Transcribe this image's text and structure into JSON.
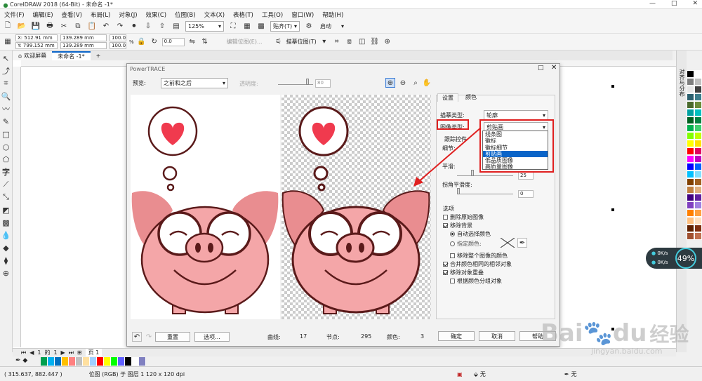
{
  "window": {
    "title": "CorelDRAW 2018 (64-Bit) - 未命名 -1*",
    "minimize": "—",
    "restore": "□",
    "close": "✕"
  },
  "menu": [
    "文件(F)",
    "编辑(E)",
    "查看(V)",
    "布局(L)",
    "对象(J)",
    "效果(C)",
    "位图(B)",
    "文本(X)",
    "表格(T)",
    "工具(O)",
    "窗口(W)",
    "帮助(H)"
  ],
  "toolbar": {
    "zoom": "125%",
    "snap": "贴齐(T)",
    "launch": "启动"
  },
  "property_bar": {
    "x": "X: 512.91 mm",
    "y": "Y: 799.152 mm",
    "width": "139.289 mm",
    "height": "139.289 mm",
    "scale_w": "100.0",
    "scale_h": "100.0",
    "pct": "%",
    "rotation": "0.0",
    "edit_bitmap": "编辑位图(E)...",
    "trace_bitmap": "描摹位图(T)"
  },
  "doc_tabs": [
    "欢迎屏幕",
    "未命名 -1*"
  ],
  "dialog": {
    "title": "PowerTRACE",
    "preview_label": "预览:",
    "preview_mode": "之前和之后",
    "transparency_label": "透明度:",
    "transparency_value": "80",
    "tab_settings": "设置",
    "tab_colors": "颜色",
    "trace_type_label": "描摹类型:",
    "trace_type_value": "轮廓",
    "image_type_label": "图像类型:",
    "image_type_value": "剪贴画",
    "image_type_options": [
      "线条图",
      "徽标",
      "徽标细节",
      "剪贴画",
      "低品质图像",
      "高质量图像"
    ],
    "image_type_selected": 3,
    "trace_controls": "跟踪控件",
    "detail_label": "细节:",
    "smoothing_label": "平滑:",
    "smoothing_value": "25",
    "corner_label": "拐角平滑度:",
    "corner_value": "0",
    "options_label": "选项",
    "opt_delete_original": "删除原始图像",
    "opt_remove_bg": "移除背景",
    "opt_auto_color": "自动选择颜色",
    "opt_specify_color": "指定颜色:",
    "opt_remove_whole": "移除整个图像的颜色",
    "opt_merge_adjacent": "合并颜色相同的相邻对象",
    "opt_remove_overlap": "移除对象重叠",
    "opt_group_by_color": "根据颜色分组对象",
    "reset": "重置",
    "options_btn": "选项...",
    "curves_label": "曲线:",
    "curves_value": "17",
    "nodes_label": "节点:",
    "nodes_value": "295",
    "colors_label": "颜色:",
    "colors_value": "3",
    "ok": "确定",
    "cancel": "取消",
    "help": "帮助"
  },
  "right_panel_label": "对齐与分布",
  "page_nav": {
    "current": "1",
    "of": "的",
    "total": "1",
    "page_tab": "页 1"
  },
  "status": {
    "coords": "( 315.637, 882.447 )",
    "info": "位图 (RGB) 于 图层 1 120 x 120 dpi",
    "fill_none": "无",
    "outline_none": "无"
  },
  "widget": {
    "percent": "49%",
    "up": "0K/s",
    "down": "0K/s"
  },
  "watermark": {
    "brand": "Bai",
    "paw": "du",
    "jingyan": "经验",
    "url": "jingyan.baidu.com"
  },
  "colors": {
    "accent": "#0a64c8",
    "highlight": "#e02020",
    "pig": "#f4a6a8",
    "pig_dark": "#e98d90",
    "outline": "#5a1a1a",
    "heart": "#f03a4e"
  },
  "palette": [
    "#000000",
    "#ffffff",
    "#7f7f7f",
    "#c0c0c0",
    "#e6e6e6",
    "#404040",
    "#2b5f6e",
    "#3c7d8c",
    "#4a6a2c",
    "#6b8c3a",
    "#00a0a0",
    "#00c0c0",
    "#006020",
    "#008040",
    "#00b050",
    "#40d070",
    "#80ff00",
    "#c0ff00",
    "#ffff00",
    "#ffe000",
    "#ff0000",
    "#e00060",
    "#ff00ff",
    "#c000c0",
    "#0000ff",
    "#0060ff",
    "#00c0ff",
    "#80e0ff",
    "#804000",
    "#a06020",
    "#c08040",
    "#e0b080",
    "#400080",
    "#6020a0",
    "#8040c0",
    "#a080e0",
    "#ff8000",
    "#ffa040",
    "#ffc080",
    "#ffe0c0",
    "#602000",
    "#803010",
    "#a05030",
    "#c07050"
  ],
  "bottom_palette": [
    "#00a050",
    "#00b0f0",
    "#0070c0",
    "#ffc000",
    "#ff8080",
    "#c0c0c0",
    "#ffe0a0",
    "#a0d0ff",
    "#ff0000",
    "#ffff00",
    "#00ff00",
    "#6060ff",
    "#000000",
    "#ffffff",
    "#8080c0"
  ]
}
